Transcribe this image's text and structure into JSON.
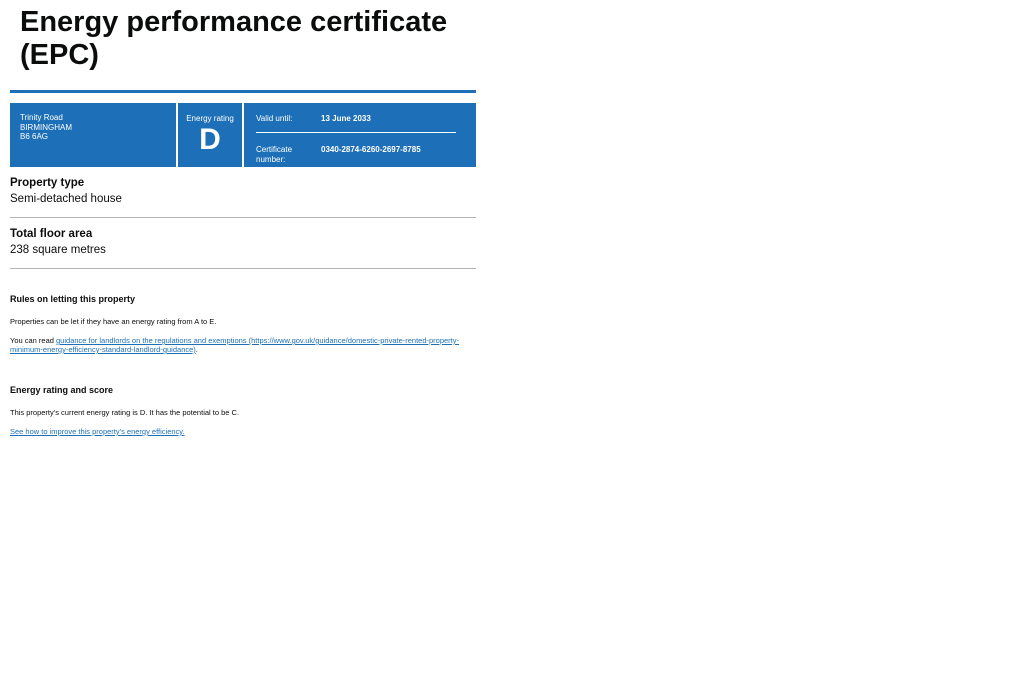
{
  "page_title": "Energy performance certificate (EPC)",
  "summary": {
    "address_line1": "Trinity Road",
    "address_line2": "BIRMINGHAM",
    "address_line3": "B6 6AG",
    "energy_rating_label": "Energy rating",
    "energy_rating_value": "D",
    "valid_until_label": "Valid until:",
    "valid_until_value": "13 June 2033",
    "certificate_number_label": "Certificate number:",
    "certificate_number_value": "0340-2874-6260-2697-8785"
  },
  "property_type": {
    "label": "Property type",
    "value": "Semi-detached house"
  },
  "floor_area": {
    "label": "Total floor area",
    "value": "238 square metres"
  },
  "letting_rules": {
    "heading": "Rules on letting this property",
    "para1": "Properties can be let if they have an energy rating from A to E.",
    "para2_prefix": "You can read ",
    "para2_link": "guidance for landlords on the regulations and exemptions (https://www.gov.uk/guidance/domestic-private-rented-property-minimum-energy-efficiency-standard-landlord-guidance)",
    "para2_suffix": "."
  },
  "rating_score": {
    "heading": "Energy rating and score",
    "para1": "This property's current energy rating is D. It has the potential to be C.",
    "link": "See how to improve this property's energy efficiency."
  },
  "colors": {
    "brand_blue": "#1d70b8",
    "text": "#0b0c0c",
    "divider": "#b1b4b6"
  }
}
